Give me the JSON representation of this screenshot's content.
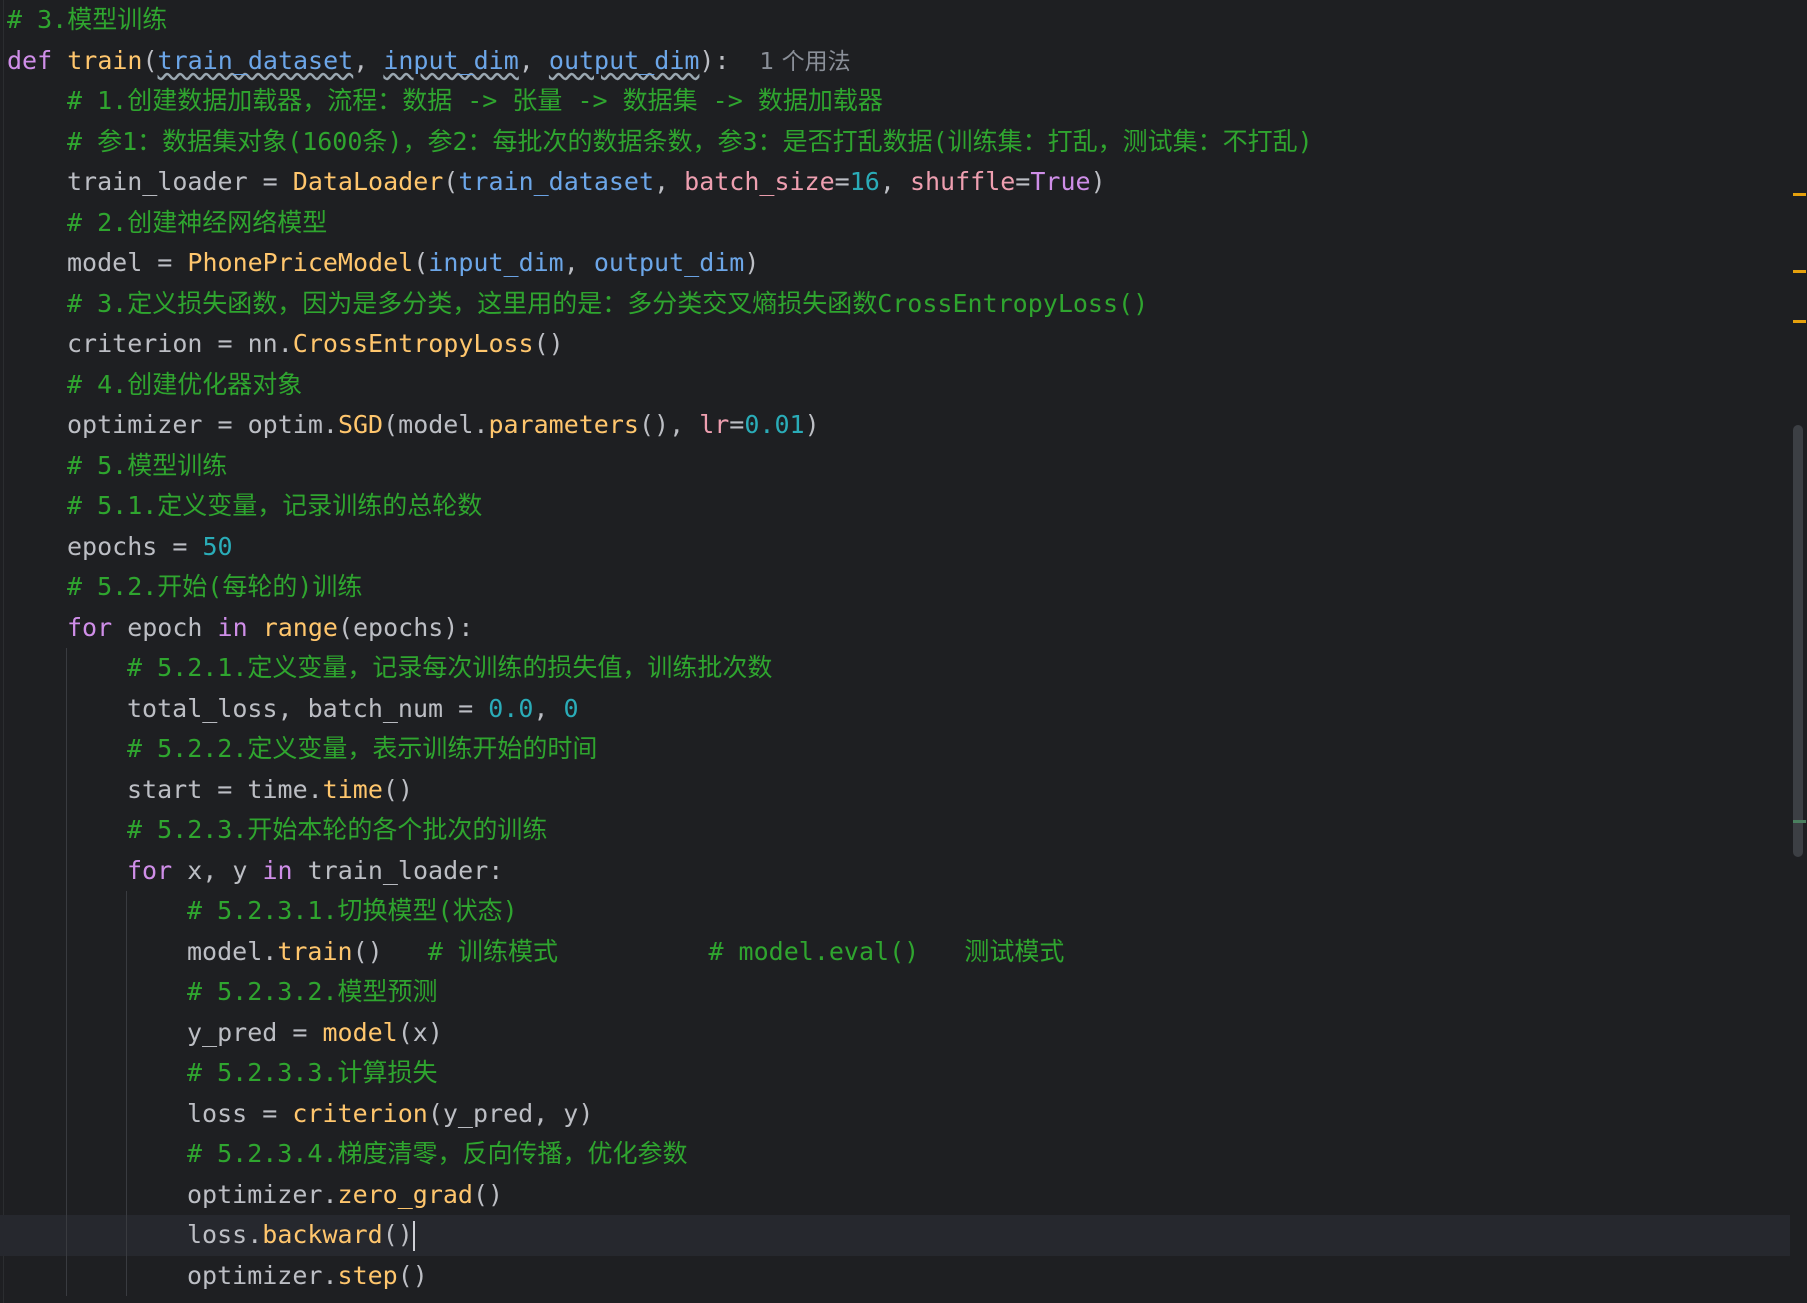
{
  "colors": {
    "background": "#1e1f22",
    "current_line": "#26282e",
    "default": "#bcbec4",
    "keyword": "#cf8ee8",
    "function": "#ffc66d",
    "param": "#6ca6e8",
    "number": "#2aacb8",
    "comment": "#2fa52f",
    "hint": "#8a8f98",
    "named_arg": "#ee9fb0",
    "marker_warning": "#e5a00d",
    "marker_info": "#4a7f5f"
  },
  "editor": {
    "usage_hint": "1 个用法",
    "lines": [
      {
        "indent": 0,
        "tokens": [
          {
            "t": "# 3.模型训练",
            "c": "comment"
          }
        ]
      },
      {
        "indent": 0,
        "tokens": [
          {
            "t": "def ",
            "c": "keyword"
          },
          {
            "t": "train",
            "c": "function"
          },
          {
            "t": "(",
            "c": "default"
          },
          {
            "t": "train_dataset",
            "c": "param",
            "u": true
          },
          {
            "t": ", ",
            "c": "default"
          },
          {
            "t": "input_dim",
            "c": "param",
            "u": true
          },
          {
            "t": ", ",
            "c": "default"
          },
          {
            "t": "output_dim",
            "c": "param",
            "u": true
          },
          {
            "t": "):  ",
            "c": "default"
          },
          {
            "t": "1 个用法",
            "c": "hint"
          }
        ]
      },
      {
        "indent": 1,
        "tokens": [
          {
            "t": "# 1.创建数据加载器，流程：数据 -> 张量 -> 数据集 -> 数据加载器",
            "c": "comment"
          }
        ]
      },
      {
        "indent": 1,
        "tokens": [
          {
            "t": "# 参1：数据集对象(1600条)，参2：每批次的数据条数，参3：是否打乱数据(训练集：打乱，测试集：不打乱)",
            "c": "comment"
          }
        ]
      },
      {
        "indent": 1,
        "tokens": [
          {
            "t": "train_loader = ",
            "c": "default"
          },
          {
            "t": "DataLoader",
            "c": "function"
          },
          {
            "t": "(",
            "c": "default"
          },
          {
            "t": "train_dataset",
            "c": "param"
          },
          {
            "t": ", ",
            "c": "default"
          },
          {
            "t": "batch_size",
            "c": "named_arg"
          },
          {
            "t": "=",
            "c": "default"
          },
          {
            "t": "16",
            "c": "number"
          },
          {
            "t": ", ",
            "c": "default"
          },
          {
            "t": "shuffle",
            "c": "named_arg"
          },
          {
            "t": "=",
            "c": "default"
          },
          {
            "t": "True",
            "c": "keyword"
          },
          {
            "t": ")",
            "c": "default"
          }
        ]
      },
      {
        "indent": 1,
        "tokens": [
          {
            "t": "# 2.创建神经网络模型",
            "c": "comment"
          }
        ]
      },
      {
        "indent": 1,
        "tokens": [
          {
            "t": "model = ",
            "c": "default"
          },
          {
            "t": "PhonePriceModel",
            "c": "function"
          },
          {
            "t": "(",
            "c": "default"
          },
          {
            "t": "input_dim",
            "c": "param"
          },
          {
            "t": ", ",
            "c": "default"
          },
          {
            "t": "output_dim",
            "c": "param"
          },
          {
            "t": ")",
            "c": "default"
          }
        ]
      },
      {
        "indent": 1,
        "tokens": [
          {
            "t": "# 3.定义损失函数，因为是多分类，这里用的是：多分类交叉熵损失函数CrossEntropyLoss()",
            "c": "comment"
          }
        ]
      },
      {
        "indent": 1,
        "tokens": [
          {
            "t": "criterion = nn.",
            "c": "default"
          },
          {
            "t": "CrossEntropyLoss",
            "c": "function"
          },
          {
            "t": "()",
            "c": "default"
          }
        ]
      },
      {
        "indent": 1,
        "tokens": [
          {
            "t": "# 4.创建优化器对象",
            "c": "comment"
          }
        ]
      },
      {
        "indent": 1,
        "tokens": [
          {
            "t": "optimizer = optim.",
            "c": "default"
          },
          {
            "t": "SGD",
            "c": "function"
          },
          {
            "t": "(model.",
            "c": "default"
          },
          {
            "t": "parameters",
            "c": "function"
          },
          {
            "t": "(), ",
            "c": "default"
          },
          {
            "t": "lr",
            "c": "named_arg"
          },
          {
            "t": "=",
            "c": "default"
          },
          {
            "t": "0.01",
            "c": "number"
          },
          {
            "t": ")",
            "c": "default"
          }
        ]
      },
      {
        "indent": 1,
        "tokens": [
          {
            "t": "# 5.模型训练",
            "c": "comment"
          }
        ]
      },
      {
        "indent": 1,
        "tokens": [
          {
            "t": "# 5.1.定义变量，记录训练的总轮数",
            "c": "comment"
          }
        ]
      },
      {
        "indent": 1,
        "tokens": [
          {
            "t": "epochs = ",
            "c": "default"
          },
          {
            "t": "50",
            "c": "number"
          }
        ]
      },
      {
        "indent": 1,
        "tokens": [
          {
            "t": "# 5.2.开始(每轮的)训练",
            "c": "comment"
          }
        ]
      },
      {
        "indent": 1,
        "tokens": [
          {
            "t": "for",
            "c": "keyword"
          },
          {
            "t": " epoch ",
            "c": "default"
          },
          {
            "t": "in",
            "c": "keyword"
          },
          {
            "t": " ",
            "c": "default"
          },
          {
            "t": "range",
            "c": "function"
          },
          {
            "t": "(epochs):",
            "c": "default"
          }
        ]
      },
      {
        "indent": 2,
        "tokens": [
          {
            "t": "# 5.2.1.定义变量，记录每次训练的损失值，训练批次数",
            "c": "comment"
          }
        ]
      },
      {
        "indent": 2,
        "tokens": [
          {
            "t": "total_loss, batch_num = ",
            "c": "default"
          },
          {
            "t": "0.0",
            "c": "number"
          },
          {
            "t": ", ",
            "c": "default"
          },
          {
            "t": "0",
            "c": "number"
          }
        ]
      },
      {
        "indent": 2,
        "tokens": [
          {
            "t": "# 5.2.2.定义变量，表示训练开始的时间",
            "c": "comment"
          }
        ]
      },
      {
        "indent": 2,
        "tokens": [
          {
            "t": "start = time.",
            "c": "default"
          },
          {
            "t": "time",
            "c": "function"
          },
          {
            "t": "()",
            "c": "default"
          }
        ]
      },
      {
        "indent": 2,
        "tokens": [
          {
            "t": "# 5.2.3.开始本轮的各个批次的训练",
            "c": "comment"
          }
        ]
      },
      {
        "indent": 2,
        "tokens": [
          {
            "t": "for",
            "c": "keyword"
          },
          {
            "t": " x, y ",
            "c": "default"
          },
          {
            "t": "in",
            "c": "keyword"
          },
          {
            "t": " train_loader:",
            "c": "default"
          }
        ]
      },
      {
        "indent": 3,
        "tokens": [
          {
            "t": "# 5.2.3.1.切换模型(状态)",
            "c": "comment"
          }
        ]
      },
      {
        "indent": 3,
        "tokens": [
          {
            "t": "model.",
            "c": "default"
          },
          {
            "t": "train",
            "c": "function"
          },
          {
            "t": "()   ",
            "c": "default"
          },
          {
            "t": "# 训练模式          # model.eval()   测试模式",
            "c": "comment"
          }
        ]
      },
      {
        "indent": 3,
        "tokens": [
          {
            "t": "# 5.2.3.2.模型预测",
            "c": "comment"
          }
        ]
      },
      {
        "indent": 3,
        "tokens": [
          {
            "t": "y_pred = ",
            "c": "default"
          },
          {
            "t": "model",
            "c": "function"
          },
          {
            "t": "(x)",
            "c": "default"
          }
        ]
      },
      {
        "indent": 3,
        "tokens": [
          {
            "t": "# 5.2.3.3.计算损失",
            "c": "comment"
          }
        ]
      },
      {
        "indent": 3,
        "tokens": [
          {
            "t": "loss = ",
            "c": "default"
          },
          {
            "t": "criterion",
            "c": "function"
          },
          {
            "t": "(y_pred, y)",
            "c": "default"
          }
        ]
      },
      {
        "indent": 3,
        "tokens": [
          {
            "t": "# 5.2.3.4.梯度清零，反向传播，优化参数",
            "c": "comment"
          }
        ]
      },
      {
        "indent": 3,
        "tokens": [
          {
            "t": "optimizer.",
            "c": "default"
          },
          {
            "t": "zero_grad",
            "c": "function"
          },
          {
            "t": "()",
            "c": "default"
          }
        ]
      },
      {
        "indent": 3,
        "current": true,
        "tokens": [
          {
            "t": "loss.",
            "c": "default"
          },
          {
            "t": "backward",
            "c": "function"
          },
          {
            "t": "()",
            "c": "default"
          }
        ]
      },
      {
        "indent": 3,
        "tokens": [
          {
            "t": "optimizer.",
            "c": "default"
          },
          {
            "t": "step",
            "c": "function"
          },
          {
            "t": "()",
            "c": "default"
          }
        ]
      }
    ]
  },
  "scrollbar": {
    "markers": [
      {
        "kind": "warning"
      },
      {
        "kind": "warning"
      },
      {
        "kind": "warning"
      },
      {
        "kind": "info"
      }
    ]
  }
}
